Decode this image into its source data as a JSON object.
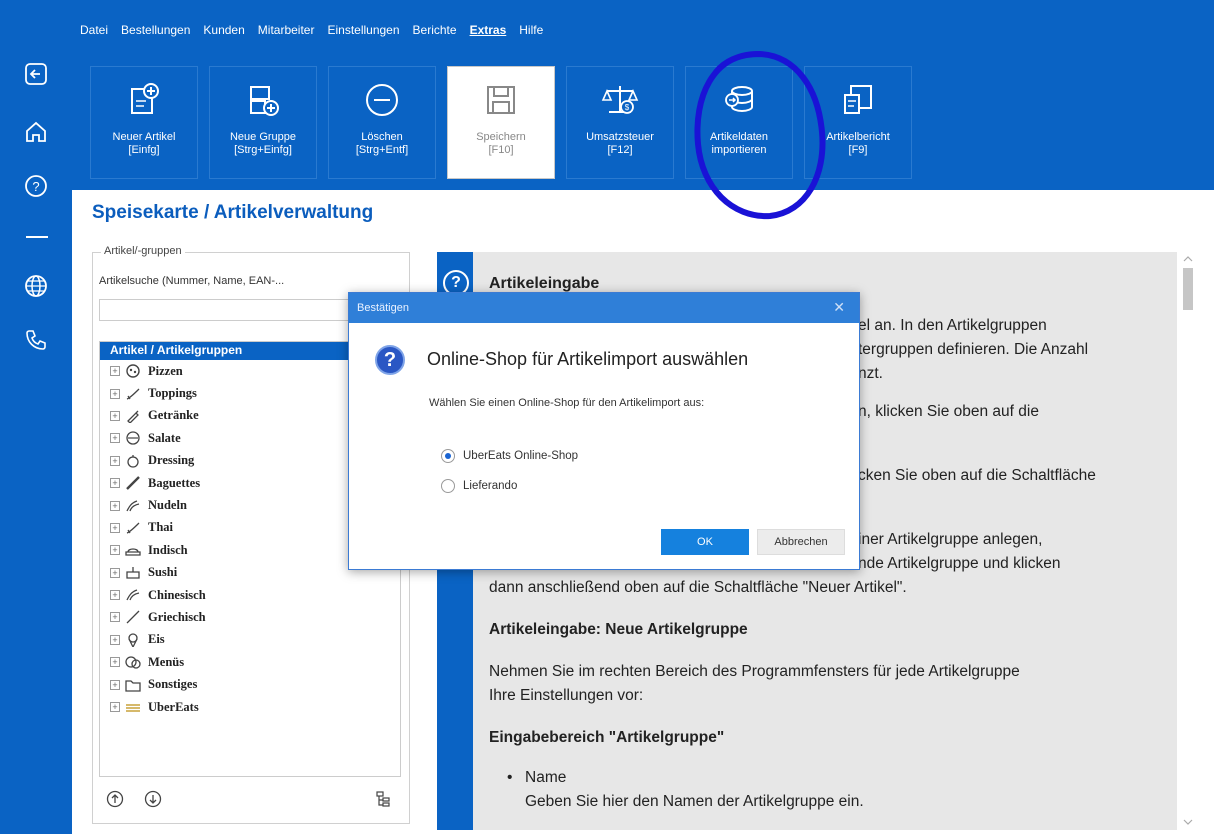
{
  "menu": [
    "Datei",
    "Bestellungen",
    "Kunden",
    "Mitarbeiter",
    "Einstellungen",
    "Berichte",
    "Extras",
    "Hilfe"
  ],
  "active_menu": "Extras",
  "ribbon": [
    {
      "line1": "Neuer Artikel",
      "line2": "[Einfg]",
      "icon": "new-article-icon"
    },
    {
      "line1": "Neue Gruppe",
      "line2": "[Strg+Einfg]",
      "icon": "new-group-icon"
    },
    {
      "line1": "Löschen",
      "line2": "[Strg+Entf]",
      "icon": "minus-circle-icon"
    },
    {
      "line1": "Speichern",
      "line2": "[F10]",
      "icon": "save-icon"
    },
    {
      "line1": "Umsatzsteuer",
      "line2": "[F12]",
      "icon": "tax-icon"
    },
    {
      "line1": "Artikeldaten",
      "line2": "importieren",
      "icon": "database-import-icon"
    },
    {
      "line1": "Artikelbericht",
      "line2": "[F9]",
      "icon": "report-icon"
    }
  ],
  "page_title": "Speisekarte / Artikelverwaltung",
  "left_panel": {
    "legend": "Artikel/-gruppen",
    "search_label": "Artikelsuche (Nummer, Name, EAN-...",
    "search_value": "",
    "tree_root": "Artikel / Artikelgruppen",
    "items": [
      "Pizzen",
      "Toppings",
      "Getränke",
      "Salate",
      "Dressing",
      "Baguettes",
      "Nudeln",
      "Thai",
      "Indisch",
      "Sushi",
      "Chinesisch",
      "Griechisch",
      "Eis",
      "Menüs",
      "Sonstiges",
      "UberEats"
    ]
  },
  "help": {
    "title": "Artikeleingabe",
    "frag1": "el an. In den Artikelgruppen",
    "frag2": "tergruppen definieren. Die Anzahl",
    "frag3": "nzt.",
    "frag4": "n, klicken Sie oben auf die",
    "frag5": "cken Sie oben auf die Schaltfläche",
    "frag6": "iner Artikelgruppe anlegen,",
    "frag7": "nde Artikelgruppe und klicken",
    "frag8": "dann anschließend oben auf die Schaltfläche \"Neuer Artikel\".",
    "heading2": "Artikeleingabe: Neue Artikelgruppe",
    "para2_line1": "Nehmen Sie im rechten Bereich des Programmfensters für jede Artikelgruppe",
    "para2_line2": "Ihre Einstellungen vor:",
    "heading3": "Eingabebereich \"Artikelgruppe\"",
    "bullet_title": "Name",
    "bullet_text": "Geben Sie hier den Namen der Artikelgruppe ein."
  },
  "dialog": {
    "title": "Bestätigen",
    "heading": "Online-Shop für Artikelimport auswählen",
    "text": "Wählen Sie einen Online-Shop für den Artikelimport aus:",
    "options": [
      "UberEats Online-Shop",
      "Lieferando"
    ],
    "selected": "UberEats Online-Shop",
    "ok": "OK",
    "cancel": "Abbrechen"
  },
  "colors": {
    "accent": "#0a63c4",
    "annotation": "#1a12d6"
  }
}
